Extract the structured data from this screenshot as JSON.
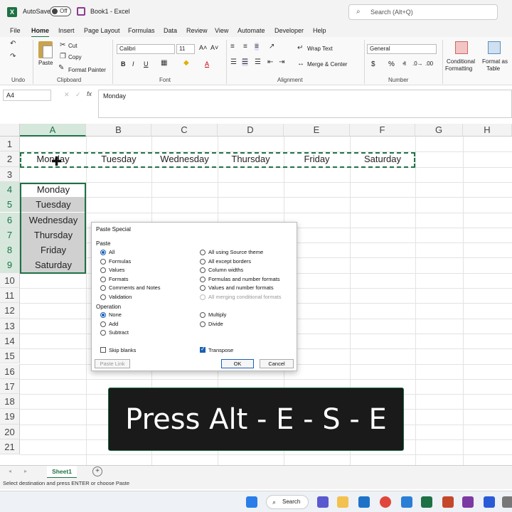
{
  "titlebar": {
    "logo": "X",
    "autosave_label": "AutoSave",
    "autosave_state": "Off",
    "document_title": "Book1 - Excel",
    "search_placeholder": "Search (Alt+Q)"
  },
  "menu": {
    "tabs": [
      "File",
      "Home",
      "Insert",
      "Page Layout",
      "Formulas",
      "Data",
      "Review",
      "View",
      "Automate",
      "Developer",
      "Help"
    ],
    "active": "Home"
  },
  "ribbon": {
    "undo_label": "Undo",
    "clipboard": {
      "label": "Clipboard",
      "paste": "Paste",
      "cut": "Cut",
      "copy": "Copy",
      "format_painter": "Format Painter"
    },
    "font": {
      "label": "Font",
      "name": "Calibri",
      "size": "11",
      "bold": "B",
      "italic": "I",
      "underline": "U"
    },
    "alignment": {
      "label": "Alignment",
      "wrap_text": "Wrap Text",
      "merge_center": "Merge & Center"
    },
    "number": {
      "label": "Number",
      "format": "General",
      "currency": "$",
      "percent": "%"
    },
    "styles": {
      "conditional_formatting_1": "Conditional",
      "conditional_formatting_2": "Formatting",
      "format_as_table_1": "Format as",
      "format_as_table_2": "Table"
    }
  },
  "formula_bar": {
    "name_box": "A4",
    "fx": "fx",
    "content": "Monday"
  },
  "grid": {
    "columns": [
      "A",
      "B",
      "C",
      "D",
      "E",
      "F",
      "G",
      "H"
    ],
    "rows": [
      "1",
      "2",
      "3",
      "4",
      "5",
      "6",
      "7",
      "8",
      "9",
      "10",
      "11",
      "12",
      "13",
      "14",
      "15",
      "16",
      "17",
      "18",
      "19",
      "20",
      "21"
    ],
    "row2": [
      "Monday",
      "Tuesday",
      "Wednesday",
      "Thursday",
      "Friday",
      "Saturday"
    ],
    "colA": [
      "Monday",
      "Tuesday",
      "Wednesday",
      "Thursday",
      "Friday",
      "Saturday"
    ]
  },
  "dialog": {
    "title": "Paste Special",
    "paste_section": "Paste",
    "paste_options_left": [
      "All",
      "Formulas",
      "Values",
      "Formats",
      "Comments and Notes",
      "Validation"
    ],
    "paste_options_right": [
      "All using Source theme",
      "All except borders",
      "Column widths",
      "Formulas and number formats",
      "Values and number formats",
      "All merging conditional formats"
    ],
    "operation_section": "Operation",
    "operation_left": [
      "None",
      "Add",
      "Subtract"
    ],
    "operation_right": [
      "Multiply",
      "Divide"
    ],
    "skip_blanks": "Skip blanks",
    "transpose": "Transpose",
    "paste_link": "Paste Link",
    "ok": "OK",
    "cancel": "Cancel"
  },
  "overlay_text": "Press Alt - E - S - E",
  "sheet_tab": "Sheet1",
  "status_text": "Select destination and press ENTER or choose Paste",
  "taskbar": {
    "search": "Search"
  },
  "colors": {
    "excel_green": "#1e7145",
    "accent_blue": "#1a5fb4",
    "overlay_bg": "#1a1a1a"
  }
}
